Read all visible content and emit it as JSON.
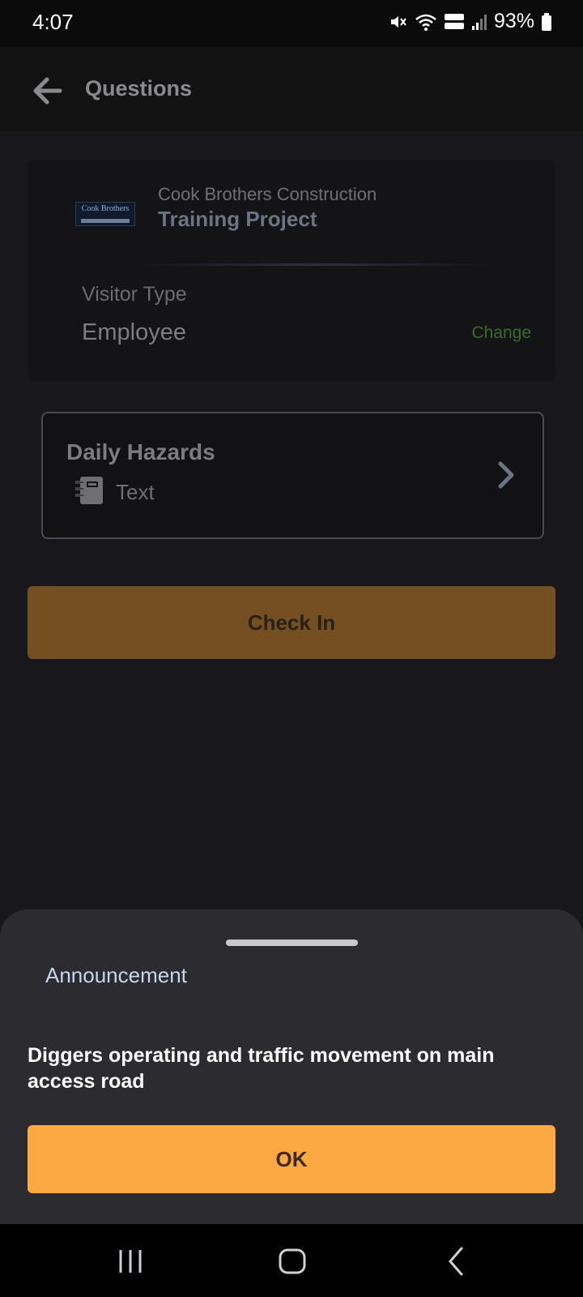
{
  "status_bar": {
    "time": "4:07",
    "battery_percent": "93%",
    "icons": [
      "mute-icon",
      "wifi-icon",
      "volte-lte2-icon",
      "signal-icon",
      "battery-icon"
    ]
  },
  "header": {
    "title": "Questions",
    "back_icon": "arrow-left-icon"
  },
  "project_card": {
    "logo_text": "Cook Brothers",
    "company": "Cook Brothers Construction",
    "project": "Training Project",
    "visitor_type_label": "Visitor Type",
    "visitor_type_value": "Employee",
    "change_label": "Change"
  },
  "question_item": {
    "title": "Daily Hazards",
    "type": "Text",
    "icon": "notebook-icon"
  },
  "check_in_label": "Check In",
  "announcement": {
    "title": "Announcement",
    "message": "Diggers operating and traffic movement on main access road",
    "ok_label": "OK"
  },
  "colors": {
    "accent": "#fca943",
    "accent_dimmed": "#744f21",
    "change_link": "#3b6b2c",
    "background": "#18171b",
    "sheet": "#2c2b30"
  }
}
